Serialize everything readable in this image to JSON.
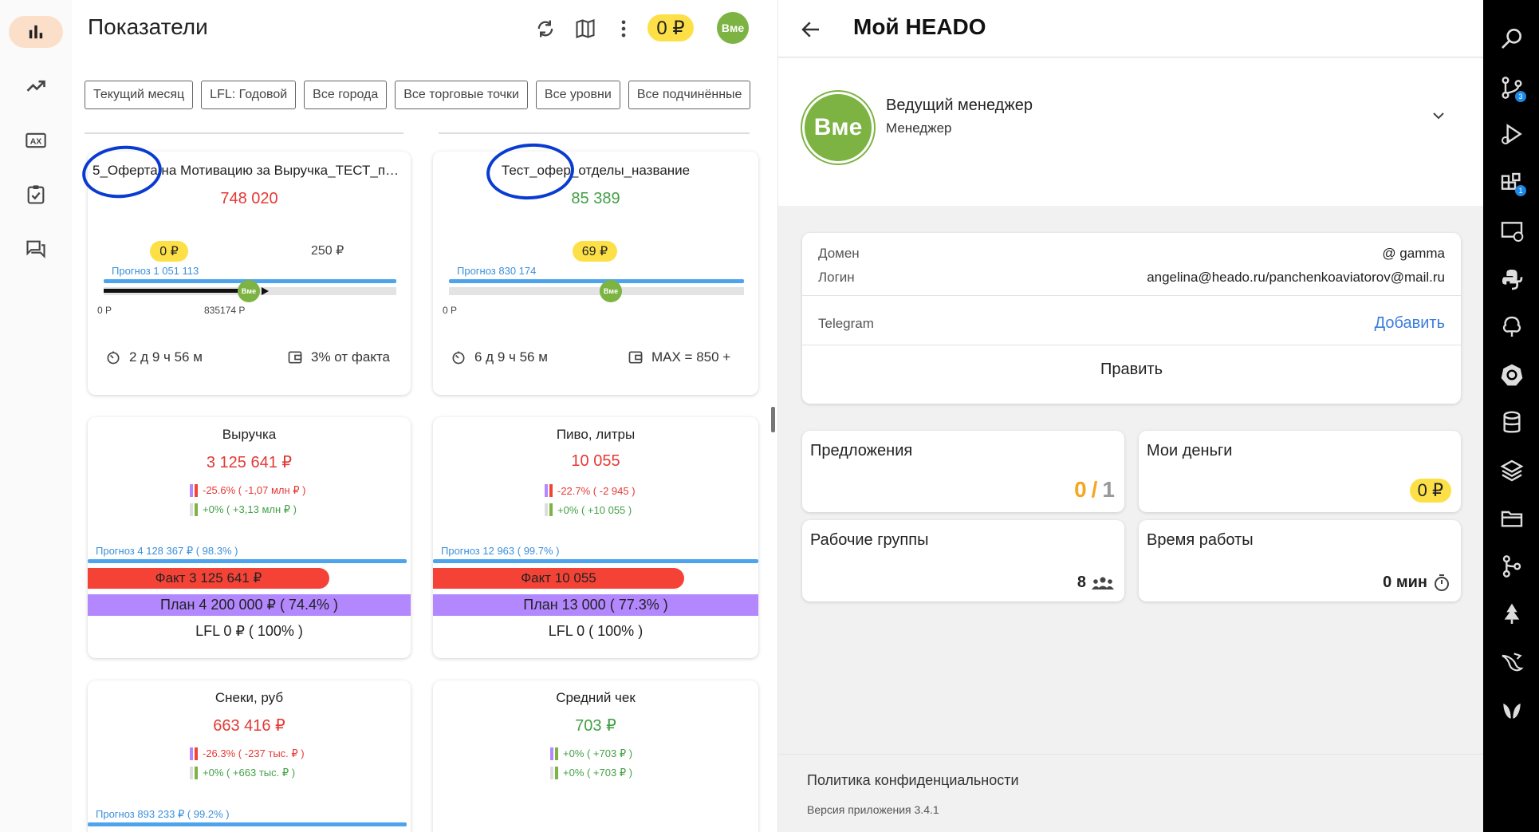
{
  "header": {
    "title": "Показатели",
    "money": "0 ₽",
    "avatar": "Вме"
  },
  "nav": {
    "items": [
      "dashboard-icon",
      "trending-icon",
      "ax-icon",
      "checklist-icon",
      "chat-icon"
    ]
  },
  "filters": [
    "Текущий месяц",
    "LFL: Годовой",
    "Все города",
    "Все торговые точки",
    "Все уровни",
    "Все подчинённые"
  ],
  "offer_cards": [
    {
      "title": "5_Оферта на Мотивацию за Выручка_ТЕСТ_про...",
      "value": "748 020",
      "pill": "0 ₽",
      "target": "250 ₽",
      "forecast": "Прогноз 1 051 113",
      "min": "0 Р",
      "mark": "835174 Р",
      "progress": 0.49,
      "time": "2 д 9 ч 56 м",
      "bonus": "3% от факта"
    },
    {
      "title": "Тест_офер_отделы_название",
      "value": "85 389",
      "pill": "69 ₽",
      "forecast": "Прогноз 830 174",
      "min": "0 Р",
      "progress": 0.55,
      "time": "6 д 9 ч 56 м",
      "bonus": "MAX = 850 +"
    }
  ],
  "metric_cards": [
    {
      "title": "Выручка",
      "value": "3 125 641 ₽",
      "d1": "-25.6% ( -1,07 млн ₽ )",
      "d2": "+0% ( +3,13 млн ₽ )",
      "forecast": "Прогноз 4 128 367 ₽ ( 98.3% )",
      "fact": "Факт 3 125 641 ₽",
      "plan": "План 4 200 000 ₽ ( 74.4% )",
      "lfl": "LFL 0 ₽ ( 100% )"
    },
    {
      "title": "Пиво, литры",
      "value": "10 055",
      "d1": "-22.7% ( -2 945 )",
      "d2": "+0% ( +10 055 )",
      "forecast": "Прогноз 12 963 ( 99.7% )",
      "fact": "Факт 10 055",
      "plan": "План 13 000 ( 77.3% )",
      "lfl": "LFL 0 ( 100% )"
    },
    {
      "title": "Снеки, руб",
      "value": "663 416 ₽",
      "d1": "-26.3% ( -237 тыс. ₽ )",
      "d2": "+0% ( +663 тыс. ₽ )",
      "forecast": "Прогноз 893 233 ₽ ( 99.2% )"
    },
    {
      "title": "Средний чек",
      "value": "703 ₽",
      "d1": "+0% ( +703 ₽ )",
      "d2": "+0% ( +703 ₽ )"
    }
  ],
  "right": {
    "title": "Мой HEADO",
    "profile": {
      "name": "Ведущий менеджер",
      "role": "Менеджер",
      "avatar": "Вме"
    },
    "info": {
      "domain_label": "Домен",
      "domain_value": "@ gamma",
      "login_label": "Логин",
      "login_value": "angelina@heado.ru/panchenkoaviatorov@mail.ru",
      "telegram_label": "Telegram",
      "telegram_action": "Добавить",
      "edit": "Править"
    },
    "tiles": {
      "offers_title": "Предложения",
      "offers_done": "0",
      "offers_sep": "/",
      "offers_total": "1",
      "money_title": "Мои деньги",
      "money_value": "0 ₽",
      "groups_title": "Рабочие группы",
      "groups_value": "8",
      "time_title": "Время работы",
      "time_value": "0 мин"
    },
    "policy": "Политика конфиденциальности",
    "version": "Версия приложения 3.4.1"
  },
  "activity_bar": {
    "icons": [
      "search-icon",
      "source-control-icon",
      "run-debug-icon",
      "extensions-icon",
      "remote-explorer-icon",
      "python-icon",
      "tree-icon",
      "kubernetes-icon",
      "database-icon",
      "layers-icon",
      "folder-icon",
      "git-graph-icon",
      "pine-icon",
      "docker-whale-icon",
      "leaf-icon"
    ],
    "badges": {
      "source_control": "3",
      "extensions": "1"
    }
  },
  "colors": {
    "accent_yellow": "#fde047",
    "avatar_green": "#7cb342",
    "fact_red": "#f44336",
    "plan_purple": "#b388ff",
    "forecast_blue": "#4ea4ec",
    "link_blue": "#3b7ddd",
    "annotation_blue": "#0a3bd1"
  }
}
